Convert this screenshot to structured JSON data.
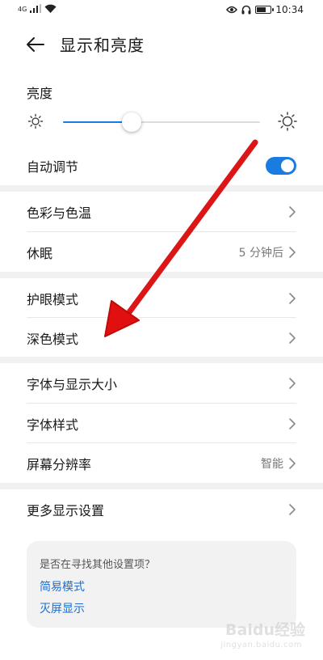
{
  "status_bar": {
    "network_type": "4G",
    "time": "10:34",
    "battery_level": 0.75
  },
  "header": {
    "title": "显示和亮度",
    "back_icon": "arrow-left-icon"
  },
  "brightness": {
    "label": "亮度",
    "level": 0.35,
    "min_icon": "sun-small-icon",
    "max_icon": "sun-large-icon"
  },
  "auto_adjust": {
    "label": "自动调节",
    "enabled": true
  },
  "rows": {
    "color_temp": {
      "label": "色彩与色温"
    },
    "sleep": {
      "label": "休眠",
      "value": "5 分钟后"
    },
    "eye_comfort": {
      "label": "护眼模式"
    },
    "dark_mode": {
      "label": "深色模式"
    },
    "font_size": {
      "label": "字体与显示大小"
    },
    "font_style": {
      "label": "字体样式"
    },
    "resolution": {
      "label": "屏幕分辨率",
      "value": "智能"
    },
    "more_settings": {
      "label": "更多显示设置"
    }
  },
  "suggestions": {
    "title": "是否在寻找其他设置项？",
    "links": [
      "简易模式",
      "灭屏显示"
    ]
  },
  "watermark": {
    "brand": "Baidu经验",
    "url": "jingyan.baidu.com"
  },
  "colors": {
    "accent": "#1a7ce0",
    "link": "#1a6fd0",
    "annotation_arrow": "#e01010"
  }
}
